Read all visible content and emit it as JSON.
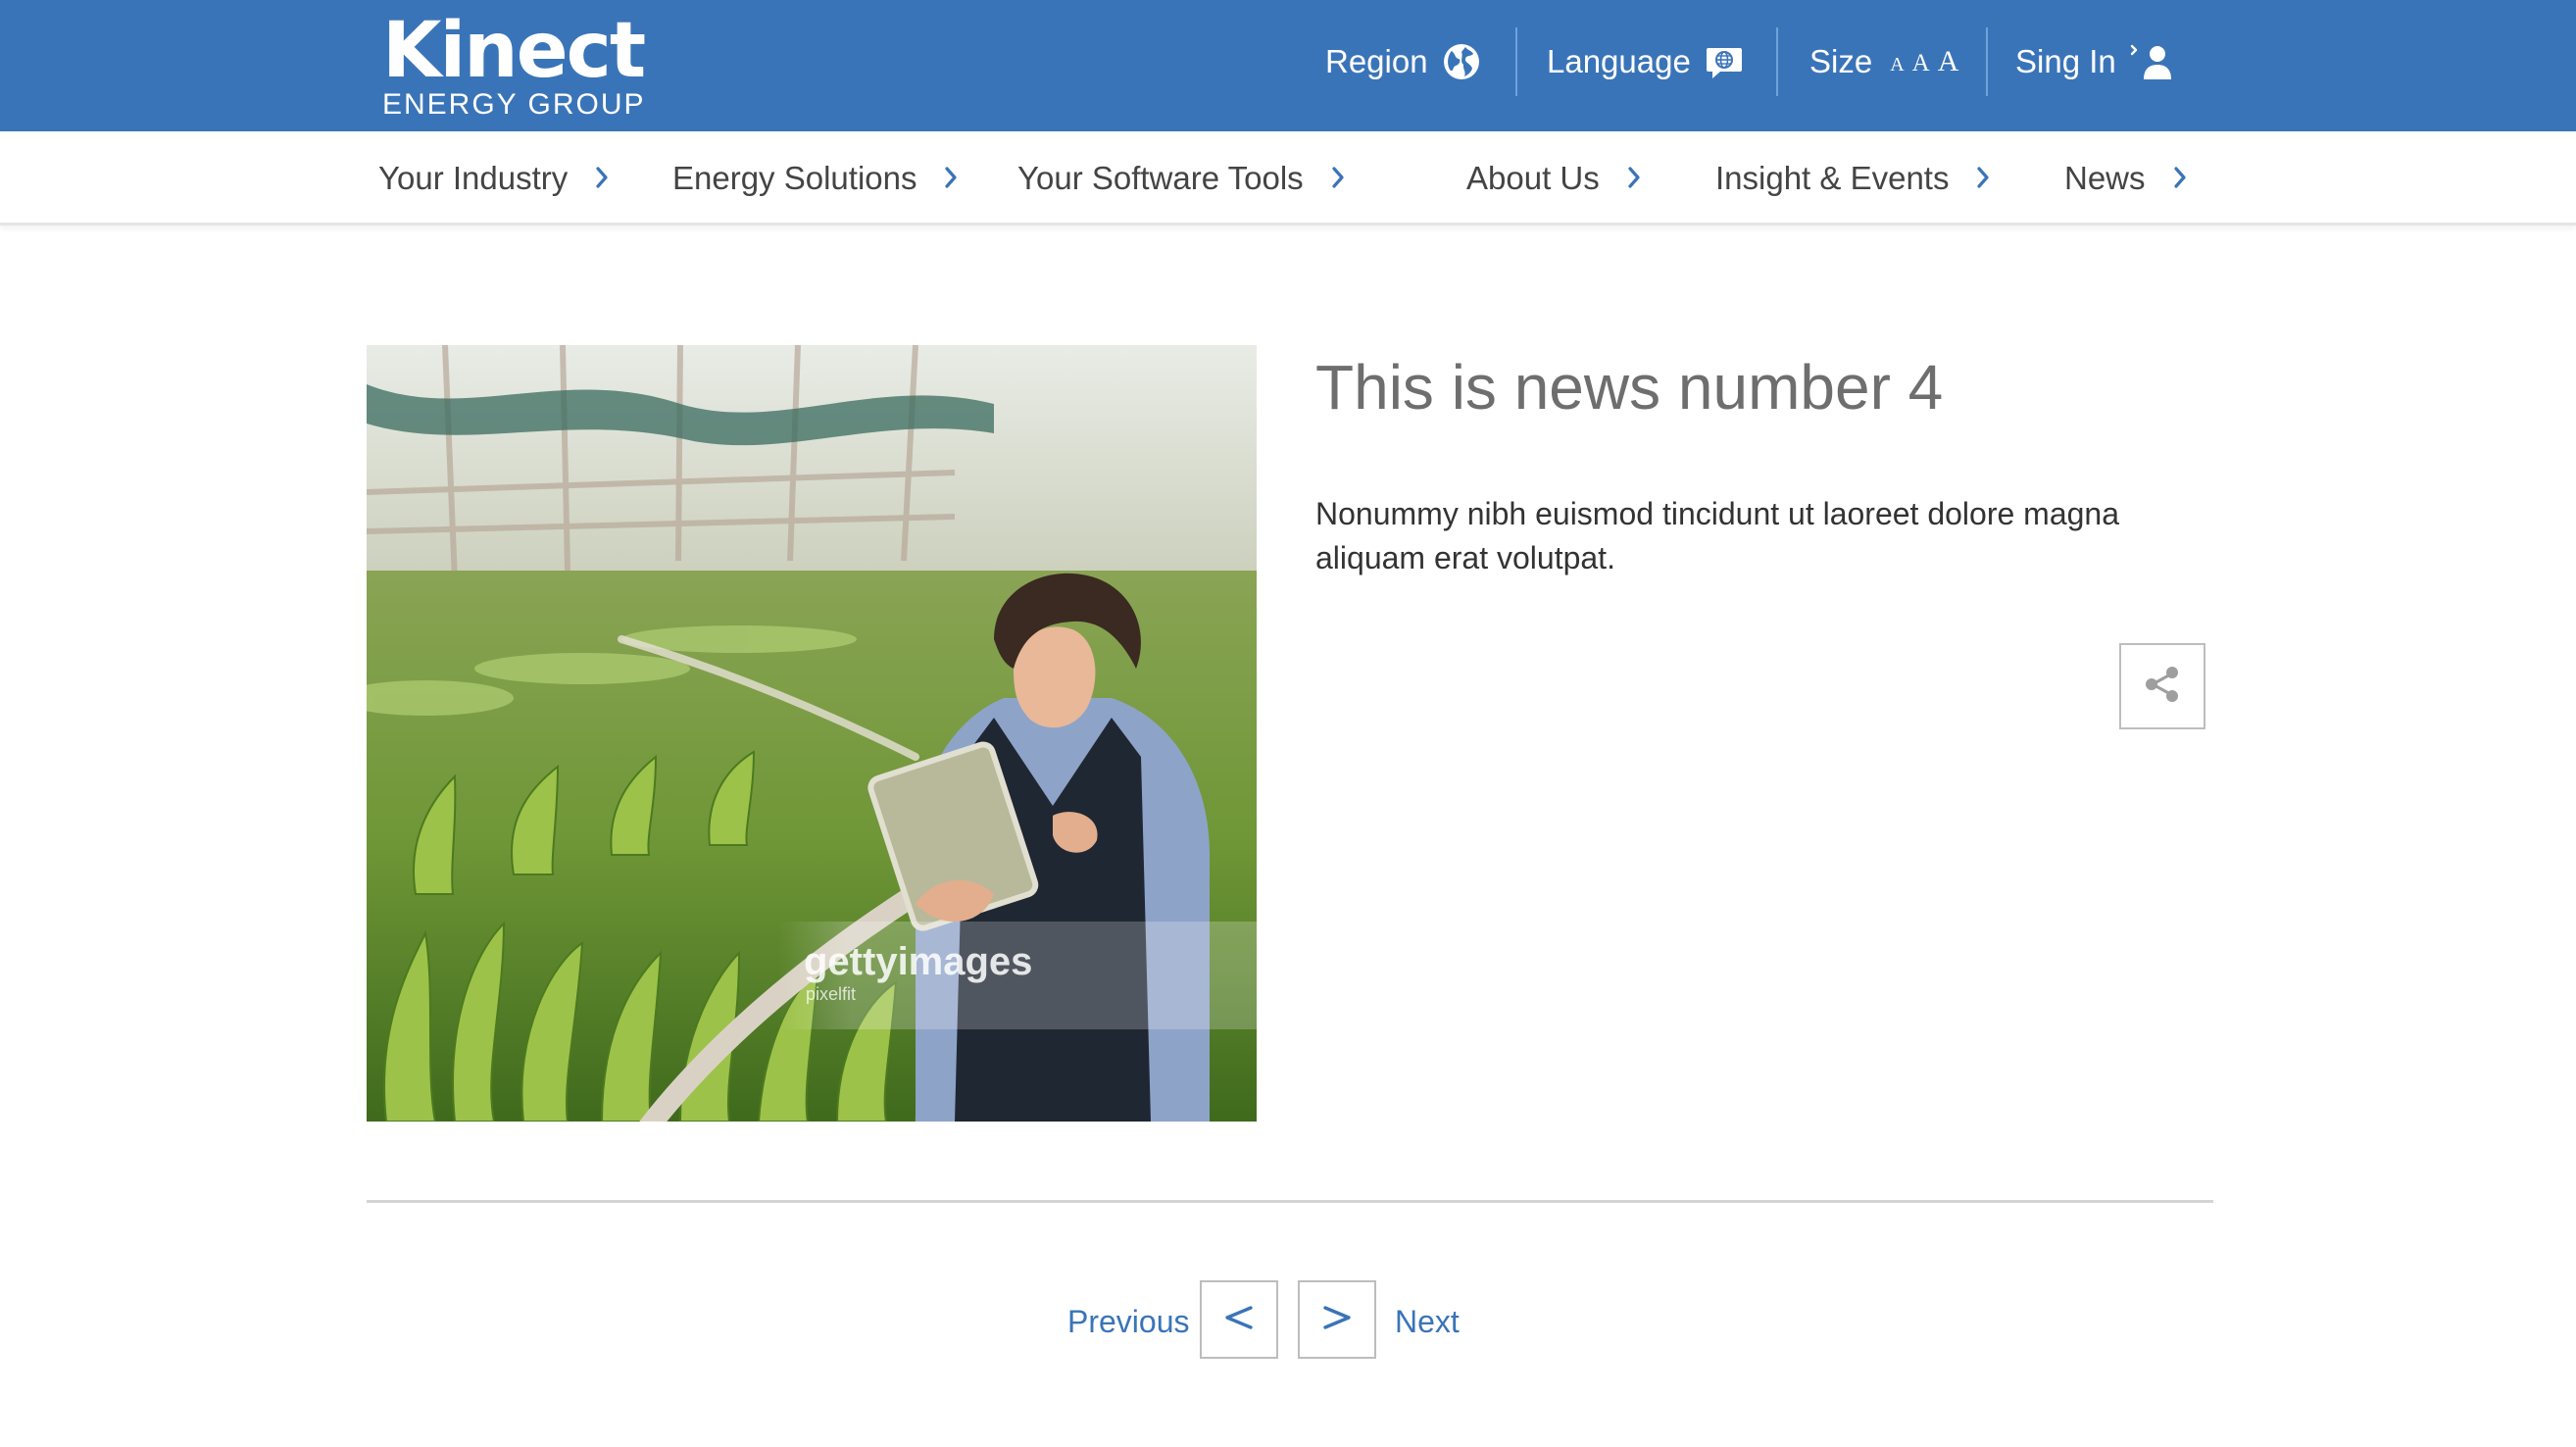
{
  "brand": {
    "name": "Kinect",
    "tagline": "ENERGY GROUP"
  },
  "utility_bar": {
    "region_label": "Region",
    "language_label": "Language",
    "size_label": "Size",
    "size_glyphs": [
      "A",
      "A",
      "A"
    ],
    "signin_label": "Sing In",
    "background_color": "#3a74b8"
  },
  "nav": {
    "items": [
      {
        "label": "Your Industry"
      },
      {
        "label": "Energy Solutions"
      },
      {
        "label": "Your Software Tools"
      },
      {
        "label": "About Us"
      },
      {
        "label": "Insight & Events"
      },
      {
        "label": "News"
      }
    ],
    "chevron_color": "#3a74b8"
  },
  "article": {
    "title": "This is news number 4",
    "body": "Nonummy nibh euismod tincidunt ut laoreet dolore magna aliquam erat volutpat.",
    "image": {
      "watermark": "gettyimages",
      "watermark_credit": "pixelfit"
    }
  },
  "pager": {
    "previous_label": "Previous",
    "next_label": "Next",
    "prev_glyph": "<",
    "next_glyph": ">",
    "accent_color": "#3a74b8"
  }
}
